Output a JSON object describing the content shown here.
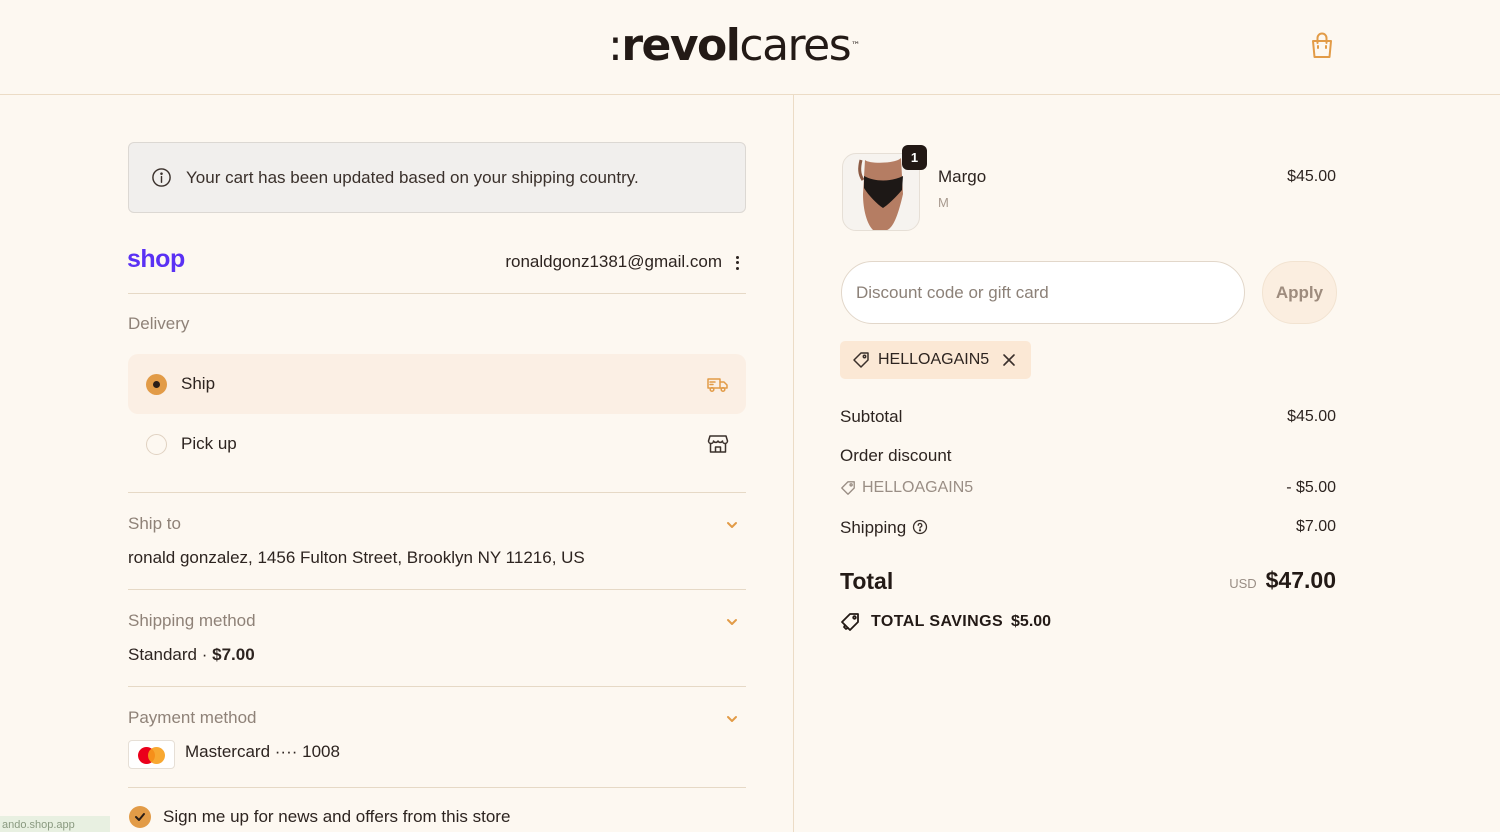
{
  "brand": {
    "logo_prefix": ":",
    "logo_bold": "revol",
    "logo_regular": "cares",
    "logo_tm": "™"
  },
  "colors": {
    "accent": "#e29b47",
    "shop_purple": "#5a31f4",
    "background": "#fdf8f1"
  },
  "header": {
    "cart_icon": "shopping-bag-icon"
  },
  "notice": {
    "text": "Your cart has been updated based on your shipping country."
  },
  "account": {
    "shop_logo": "shop",
    "email": "ronaldgonz1381@gmail.com"
  },
  "delivery": {
    "label": "Delivery",
    "options": [
      {
        "label": "Ship",
        "selected": true,
        "icon": "truck-icon"
      },
      {
        "label": "Pick up",
        "selected": false,
        "icon": "store-icon"
      }
    ]
  },
  "ship_to": {
    "label": "Ship to",
    "value": "ronald gonzalez, 1456 Fulton Street, Brooklyn NY 11216, US"
  },
  "shipping_method": {
    "label": "Shipping method",
    "name": "Standard · ",
    "price": "$7.00"
  },
  "payment_method": {
    "label": "Payment method",
    "card": "Mastercard ···· 1008"
  },
  "newsletter": {
    "label": "Sign me up for news and offers from this store",
    "checked": true
  },
  "app_badge": "ando.shop.app",
  "cart": {
    "items": [
      {
        "name": "Margo",
        "variant": "M",
        "price": "$45.00",
        "quantity": "1"
      }
    ]
  },
  "discount": {
    "placeholder": "Discount code or gift card",
    "apply_label": "Apply",
    "applied_code": "HELLOAGAIN5"
  },
  "summary": {
    "subtotal_label": "Subtotal",
    "subtotal_value": "$45.00",
    "discount_label": "Order discount",
    "discount_code": "HELLOAGAIN5",
    "discount_value": "- $5.00",
    "shipping_label": "Shipping",
    "shipping_value": "$7.00",
    "total_label": "Total",
    "currency": "USD",
    "total_value": "$47.00",
    "savings_label": "TOTAL SAVINGS",
    "savings_value": "$5.00"
  }
}
